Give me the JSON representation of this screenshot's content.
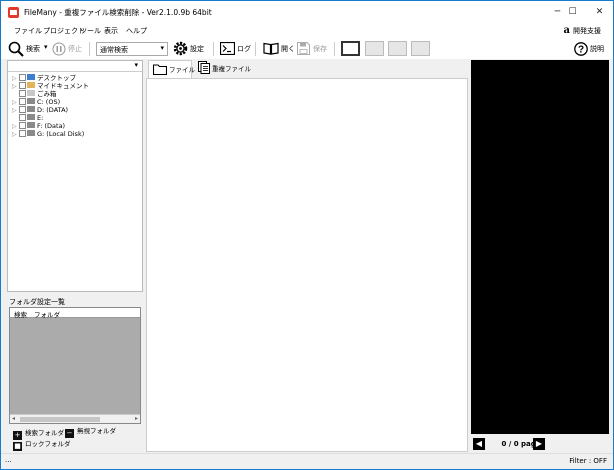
{
  "titlebar": {
    "title": "FileMany - 重複ファイル検索削除 - Ver2.1.0.9b 64bit",
    "minimize": "─",
    "maximize": "☐",
    "close": "✕"
  },
  "menu": {
    "items": [
      "ファイル",
      "プロジェクト",
      "ツール",
      "表示",
      "ヘルプ"
    ],
    "dev_support": "開発支援",
    "dev_support_logo": "a"
  },
  "toolbar": {
    "search": "検索",
    "search_arrow": "▾",
    "stop": "停止",
    "mode_value": "通常検索",
    "mode_arrow": "▾",
    "settings": "設定",
    "log": "ログ",
    "open": "開く",
    "save": "保存",
    "help": "説明"
  },
  "tree": {
    "header_arrow": "▾",
    "items": [
      {
        "label": "デスクトップ",
        "icon": "desktop-icon"
      },
      {
        "label": "マイドキュメント",
        "icon": "documents-icon"
      },
      {
        "label": "ごみ箱",
        "icon": "recycle-bin-icon"
      },
      {
        "label": "C: (OS)",
        "icon": "drive-icon"
      },
      {
        "label": "D: (DATA)",
        "icon": "drive-icon"
      },
      {
        "label": "E:",
        "icon": "drive-icon"
      },
      {
        "label": "F: (Data)",
        "icon": "drive-icon"
      },
      {
        "label": "G: (Local Disk)",
        "icon": "drive-icon"
      }
    ]
  },
  "folder_settings": {
    "title": "フォルダ設定一覧",
    "col_search": "検索",
    "col_folder": "フォルダ",
    "tabs": {
      "search_folder": "検索フォルダ",
      "ignore_folder": "無視フォルダ",
      "lock_folder": "ロックフォルダ"
    }
  },
  "center": {
    "tab_file": "ファイル",
    "tab_duplicate": "重複ファイル"
  },
  "pager": {
    "text": "0 / 0 page",
    "prev": "◀",
    "next": "▶"
  },
  "status": {
    "dots": "...",
    "filter": "Filter : OFF"
  }
}
